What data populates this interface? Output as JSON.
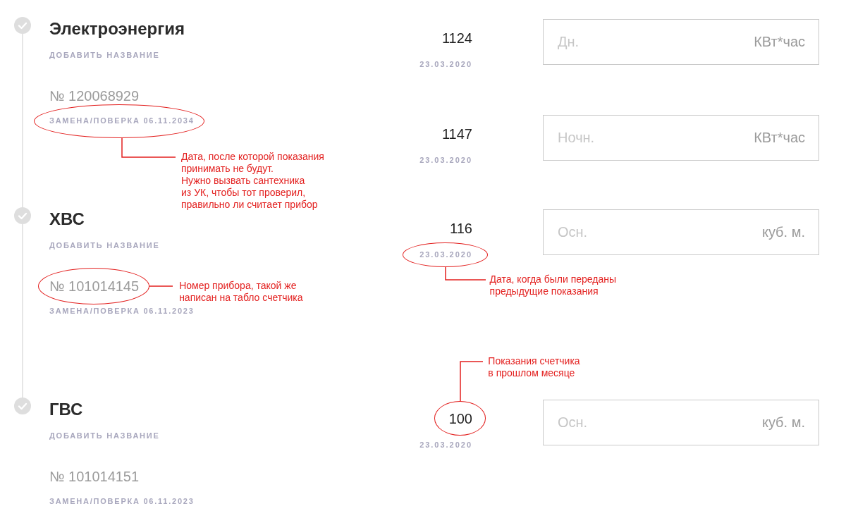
{
  "meters": [
    {
      "title": "Электроэнергия",
      "add_name": "ДОБАВИТЬ НАЗВАНИЕ",
      "number": "№ 120068929",
      "replacement": "ЗАМЕНА/ПОВЕРКА 06.11.2034",
      "replacement_note": "Дата, после которой показания\nпринимать не будут.\nНужно вызвать сантехника\nиз УК, чтобы тот проверил,\nправильно ли считает прибор",
      "readings": [
        {
          "previous": "1124",
          "date": "23.03.2020",
          "placeholder": "Дн.",
          "unit": "КВт*час"
        },
        {
          "previous": "1147",
          "date": "23.03.2020",
          "placeholder": "Ночн.",
          "unit": "КВт*час"
        }
      ]
    },
    {
      "title": "ХВС",
      "add_name": "ДОБАВИТЬ НАЗВАНИЕ",
      "number": "№ 101014145",
      "number_note": "Номер прибора, такой же\nнаписан на табло счетчика",
      "replacement": "ЗАМЕНА/ПОВЕРКА 06.11.2023",
      "readings": [
        {
          "previous": "116",
          "date": "23.03.2020",
          "date_note": "Дата, когда были переданы\nпредыдущие показания",
          "placeholder": "Осн.",
          "unit": "куб. м."
        }
      ]
    },
    {
      "title": "ГВС",
      "add_name": "ДОБАВИТЬ НАЗВАНИЕ",
      "number": "№ 101014151",
      "replacement": "ЗАМЕНА/ПОВЕРКА 06.11.2023",
      "readings": [
        {
          "previous": "100",
          "previous_note": "Показания счетчика\nв прошлом месяце",
          "date": "23.03.2020",
          "placeholder": "Осн.",
          "unit": "куб. м."
        }
      ]
    }
  ]
}
